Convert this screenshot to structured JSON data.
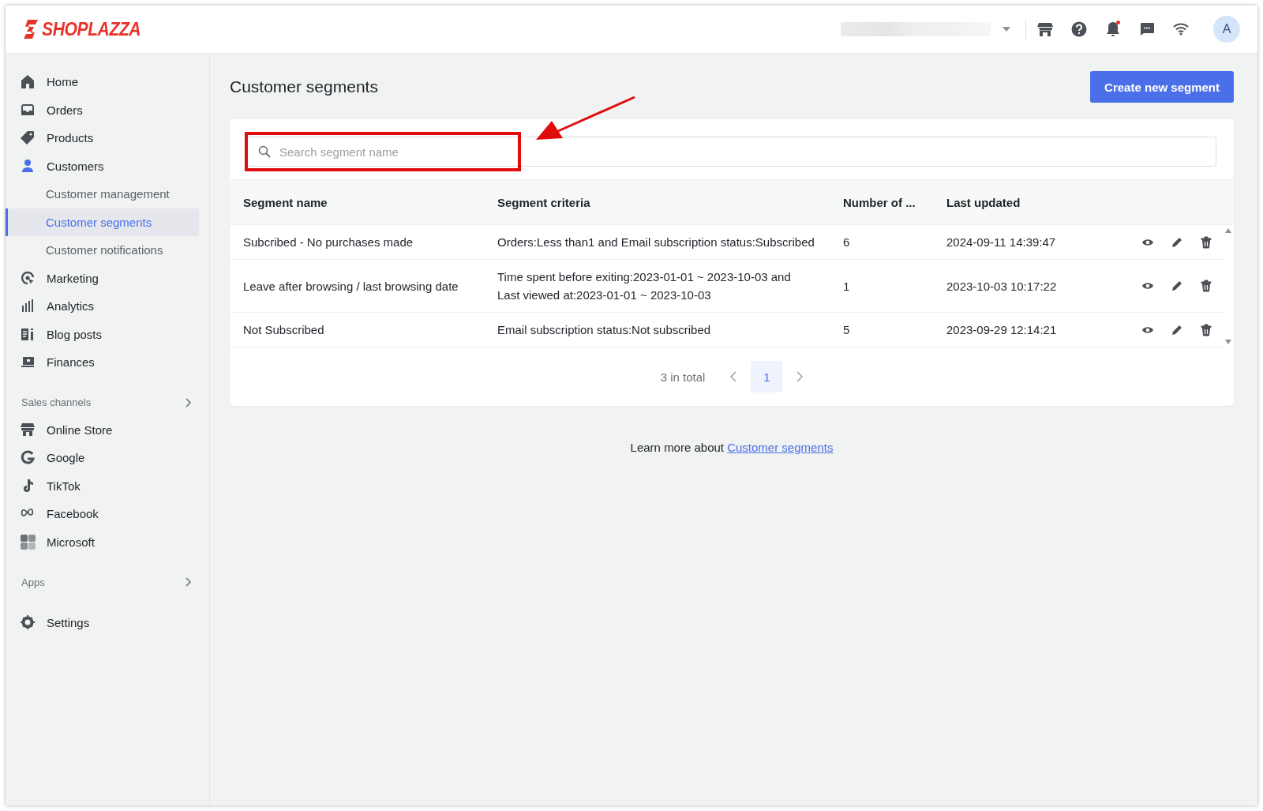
{
  "header": {
    "logo": "SHOPLAZZA",
    "avatar": "A",
    "unread_notifications": true
  },
  "sidebar": {
    "items": [
      {
        "kind": "item",
        "label": "Home",
        "selected": false
      },
      {
        "kind": "item",
        "label": "Orders",
        "selected": false
      },
      {
        "kind": "item",
        "label": "Products",
        "selected": false
      },
      {
        "kind": "item",
        "label": "Customers",
        "selected": false
      },
      {
        "kind": "subitem",
        "label": "Customer management",
        "selected": false
      },
      {
        "kind": "subitem",
        "label": "Customer segments",
        "selected": true
      },
      {
        "kind": "subitem",
        "label": "Customer notifications",
        "selected": false
      },
      {
        "kind": "item",
        "label": "Marketing",
        "selected": false
      },
      {
        "kind": "item",
        "label": "Analytics",
        "selected": false
      },
      {
        "kind": "item",
        "label": "Blog posts",
        "selected": false
      },
      {
        "kind": "item",
        "label": "Finances",
        "selected": false
      },
      {
        "kind": "section",
        "label": "Sales channels"
      },
      {
        "kind": "item",
        "label": "Online Store",
        "selected": false
      },
      {
        "kind": "item",
        "label": "Google",
        "selected": false
      },
      {
        "kind": "item",
        "label": "TikTok",
        "selected": false
      },
      {
        "kind": "item",
        "label": "Facebook",
        "selected": false
      },
      {
        "kind": "item",
        "label": "Microsoft",
        "selected": false
      },
      {
        "kind": "section",
        "label": "Apps"
      },
      {
        "kind": "item",
        "label": "Settings",
        "selected": false
      }
    ]
  },
  "page": {
    "title": "Customer segments",
    "create_button": "Create new segment",
    "search": {
      "placeholder": "Search segment name"
    },
    "table": {
      "columns": [
        "Segment name",
        "Segment criteria",
        "Number of ...",
        "Last updated"
      ],
      "rows": [
        {
          "name": "Subcribed - No purchases made",
          "criteria": "Orders:Less than1 and Email subscription status:Subscribed",
          "count": "6",
          "updated": "2024-09-11 14:39:47"
        },
        {
          "name": "Leave after browsing / last browsing date",
          "criteria": "Time spent before exiting:2023-01-01 ~ 2023-10-03 and\nLast viewed at:2023-01-01 ~ 2023-10-03",
          "count": "1",
          "updated": "2023-10-03 10:17:22"
        },
        {
          "name": "Not Subscribed",
          "criteria": "Email subscription status:Not subscribed",
          "count": "5",
          "updated": "2023-09-29 12:14:21"
        }
      ]
    },
    "pagination": {
      "total": "3 in total",
      "pages": [
        {
          "label": "1",
          "selected": true
        }
      ]
    },
    "learn_more": {
      "text": "Learn more about",
      "link": "Customer segments"
    }
  }
}
